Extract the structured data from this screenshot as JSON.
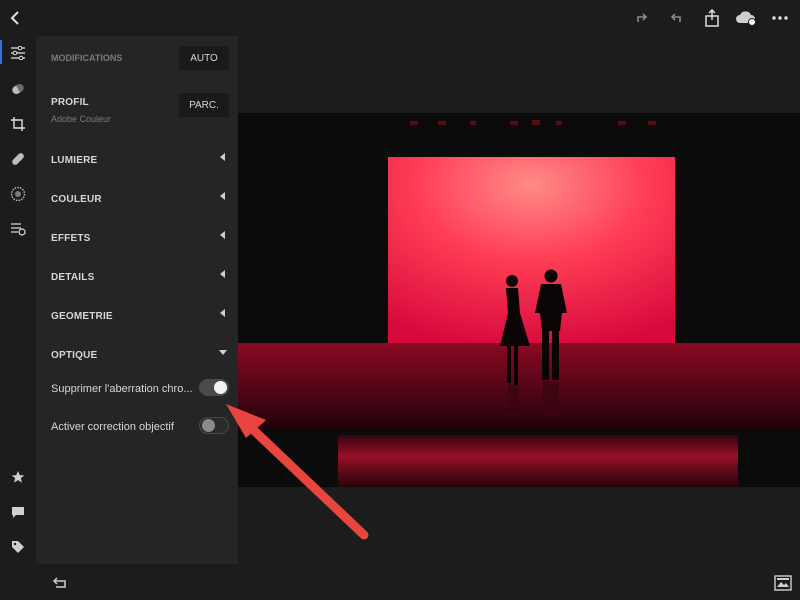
{
  "topbar": {
    "icons": [
      "back-icon",
      "redo-icon",
      "undo-icon",
      "share-icon",
      "cloud-sync-icon",
      "more-icon"
    ]
  },
  "toolrail": {
    "icons": [
      "edit-sliders-icon",
      "selective-icon",
      "crop-icon",
      "healing-icon",
      "vignette-icon",
      "presets-icon",
      "star-icon",
      "comment-icon",
      "tag-icon",
      "info-icon"
    ]
  },
  "panel": {
    "modifications_label": "MODIFICATIONS",
    "auto_label": "AUTO",
    "profil_label": "PROFIL",
    "profil_value": "Adobe Couleur",
    "parc_label": "PARC.",
    "sections": [
      "LUMIERE",
      "COULEUR",
      "EFFETS",
      "DETAILS",
      "GEOMETRIE",
      "OPTIQUE"
    ],
    "toggles": [
      {
        "label": "Supprimer l'aberration chro...",
        "state": "on"
      },
      {
        "label": "Activer correction objectif",
        "state": "off"
      }
    ]
  },
  "colors": {
    "accent": "#2d73d9",
    "arrow": "#e8453f",
    "panel_bg": "#252525"
  }
}
